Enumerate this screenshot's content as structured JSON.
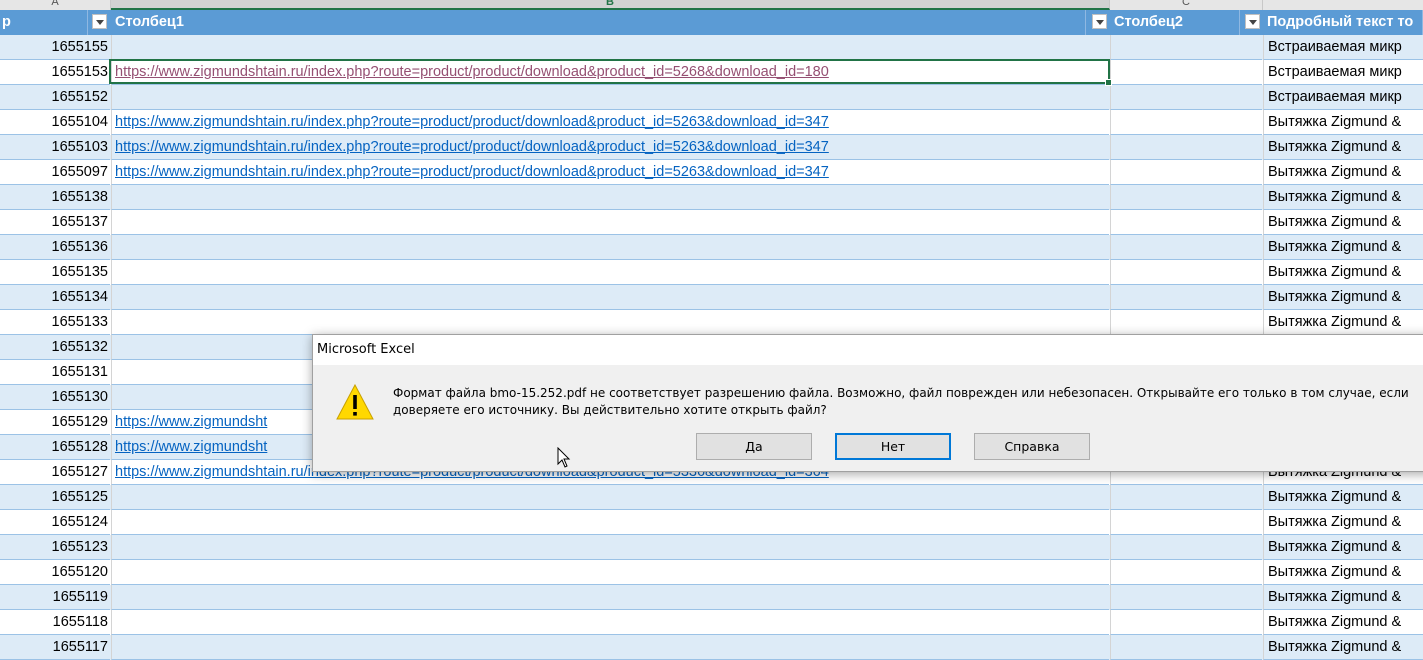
{
  "sheet": {
    "column_letters": [
      {
        "letter": "A",
        "selected": false
      },
      {
        "letter": "B",
        "selected": true
      },
      {
        "letter": "C",
        "selected": false
      },
      {
        "letter": "",
        "selected": false
      }
    ],
    "headers": {
      "col_num_suffix": "р",
      "col_a": "Столбец1",
      "col_b": "Столбец2",
      "col_c": "Подробный текст то"
    },
    "rows": [
      {
        "num": "1655155",
        "url": "",
        "visited": false,
        "text": "Встраиваемая микр"
      },
      {
        "num": "1655153",
        "url": "https://www.zigmundshtain.ru/index.php?route=product/product/download&product_id=5268&download_id=180",
        "visited": true,
        "text": "Встраиваемая микр"
      },
      {
        "num": "1655152",
        "url": "",
        "visited": false,
        "text": "Встраиваемая микр"
      },
      {
        "num": "1655104",
        "url": "https://www.zigmundshtain.ru/index.php?route=product/product/download&product_id=5263&download_id=347",
        "visited": false,
        "text": "Вытяжка Zigmund &"
      },
      {
        "num": "1655103",
        "url": "https://www.zigmundshtain.ru/index.php?route=product/product/download&product_id=5263&download_id=347",
        "visited": false,
        "text": "Вытяжка Zigmund &"
      },
      {
        "num": "1655097",
        "url": "https://www.zigmundshtain.ru/index.php?route=product/product/download&product_id=5263&download_id=347",
        "visited": false,
        "text": "Вытяжка Zigmund &"
      },
      {
        "num": "1655138",
        "url": "",
        "visited": false,
        "text": "Вытяжка Zigmund &"
      },
      {
        "num": "1655137",
        "url": "",
        "visited": false,
        "text": "Вытяжка Zigmund &"
      },
      {
        "num": "1655136",
        "url": "",
        "visited": false,
        "text": "Вытяжка Zigmund &"
      },
      {
        "num": "1655135",
        "url": "",
        "visited": false,
        "text": "Вытяжка Zigmund &"
      },
      {
        "num": "1655134",
        "url": "",
        "visited": false,
        "text": "Вытяжка Zigmund &"
      },
      {
        "num": "1655133",
        "url": "",
        "visited": false,
        "text": "Вытяжка Zigmund &"
      },
      {
        "num": "1655132",
        "url": "",
        "visited": false,
        "text": ""
      },
      {
        "num": "1655131",
        "url": "",
        "visited": false,
        "text": ""
      },
      {
        "num": "1655130",
        "url": "",
        "visited": false,
        "text": ""
      },
      {
        "num": "1655129",
        "url": "https://www.zigmundsht",
        "visited": false,
        "text": ""
      },
      {
        "num": "1655128",
        "url": "https://www.zigmundsht",
        "visited": false,
        "text": ""
      },
      {
        "num": "1655127",
        "url": "https://www.zigmundshtain.ru/index.php?route=product/product/download&product_id=5336&download_id=364",
        "visited": false,
        "text": "Вытяжка Zigmund &"
      },
      {
        "num": "1655125",
        "url": "",
        "visited": false,
        "text": "Вытяжка Zigmund &"
      },
      {
        "num": "1655124",
        "url": "",
        "visited": false,
        "text": "Вытяжка Zigmund &"
      },
      {
        "num": "1655123",
        "url": "",
        "visited": false,
        "text": "Вытяжка Zigmund &"
      },
      {
        "num": "1655120",
        "url": "",
        "visited": false,
        "text": "Вытяжка Zigmund &"
      },
      {
        "num": "1655119",
        "url": "",
        "visited": false,
        "text": "Вытяжка Zigmund &"
      },
      {
        "num": "1655118",
        "url": "",
        "visited": false,
        "text": "Вытяжка Zigmund &"
      },
      {
        "num": "1655117",
        "url": "",
        "visited": false,
        "text": "Вытяжка Zigmund &"
      }
    ]
  },
  "dialog": {
    "title": "Microsoft Excel",
    "icon": "warning-icon",
    "message_line1": "Формат файла bmo-15.252.pdf не соответствует разрешению файла. Возможно, файл поврежден или небезопасен. Открывайте его только в том случае, если",
    "message_line2": "доверяете его источнику. Вы действительно хотите открыть файл?",
    "buttons": {
      "yes": "Да",
      "no": "Нет",
      "help": "Справка"
    }
  },
  "colors": {
    "header_blue": "#5b9bd5",
    "band_blue": "#ddebf7",
    "link": "#0563c1",
    "visited_link": "#954f72",
    "selection": "#217346",
    "default_button_border": "#0078d7"
  }
}
